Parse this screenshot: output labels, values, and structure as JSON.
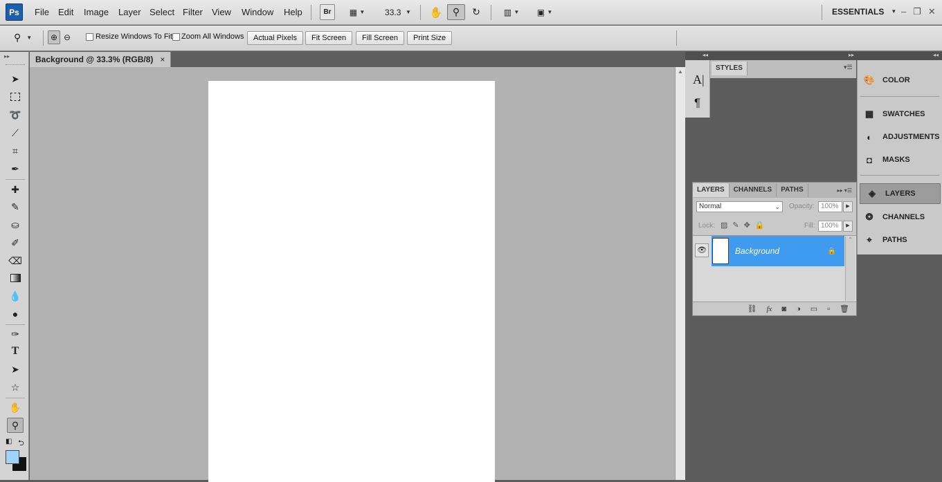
{
  "app": {
    "logo": "Ps",
    "menu": [
      "File",
      "Edit",
      "Image",
      "Layer",
      "Select",
      "Filter",
      "View",
      "Window",
      "Help"
    ],
    "bridge_label": "Br",
    "zoom_value": "33.3",
    "workspace": "ESSENTIALS"
  },
  "options": {
    "resize_windows_label": "Resize Windows To Fit",
    "zoom_all_label": "Zoom All Windows",
    "actual_pixels": "Actual Pixels",
    "fit_screen": "Fit Screen",
    "fill_screen": "Fill Screen",
    "print_size": "Print Size"
  },
  "document": {
    "tab_title": "Background @ 33.3% (RGB/8)",
    "close_glyph": "×"
  },
  "styles_panel": {
    "tab": "STYLES"
  },
  "dock": {
    "items": [
      "COLOR",
      "SWATCHES",
      "ADJUSTMENTS",
      "MASKS",
      "LAYERS",
      "CHANNELS",
      "PATHS"
    ],
    "selected": "LAYERS"
  },
  "layers_panel": {
    "tabs": [
      "LAYERS",
      "CHANNELS",
      "PATHS"
    ],
    "blend_mode": "Normal",
    "opacity_label": "Opacity:",
    "opacity_value": "100%",
    "lock_label": "Lock:",
    "fill_label": "Fill:",
    "fill_value": "100%",
    "layer_name": "Background"
  },
  "colors": {
    "foreground": "#9fd4ff",
    "background": "#111111",
    "layer_selected": "#3e9bf0"
  }
}
